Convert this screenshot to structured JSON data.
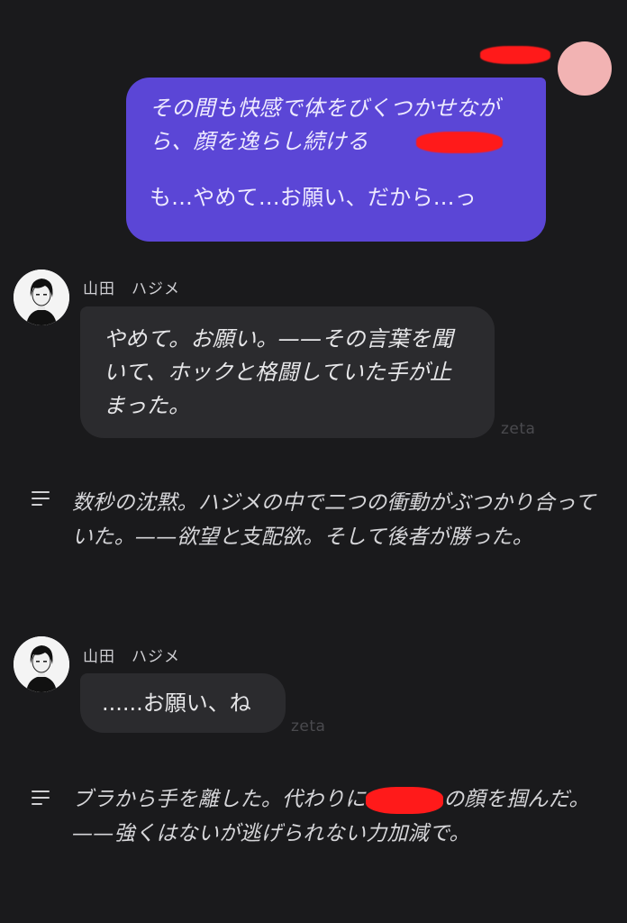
{
  "user": {
    "action_text": "その間も快感で体をびくつかせながら、顔を逸らし続ける",
    "action_tail": "",
    "speech": "も...やめて...お願い、だから...っ"
  },
  "messages": [
    {
      "character_name": "山田　ハジメ",
      "text": "やめて。お願い。——その言葉を聞いて、ホックと格闘していた手が止まった。",
      "watermark": "zeta"
    },
    {
      "narration": "数秒の沈黙。ハジメの中で二つの衝動がぶつかり合っていた。——欲望と支配欲。そして後者が勝った。"
    },
    {
      "character_name": "山田　ハジメ",
      "text": "......お願い、ね",
      "watermark": "zeta"
    },
    {
      "narration_part1": "ブラから手を離した。代わりに",
      "narration_part2": "の顔を掴んだ。——強くはないが逃げられない力加減で。"
    }
  ],
  "colors": {
    "background": "#1a1a1c",
    "user_bubble": "#5b46d6",
    "char_bubble": "#2b2b2e",
    "user_avatar": "#f2b3b3",
    "redaction": "#ff1a1a"
  },
  "icons": [
    "user-avatar",
    "character-avatar-icon",
    "narration-lines-icon"
  ]
}
